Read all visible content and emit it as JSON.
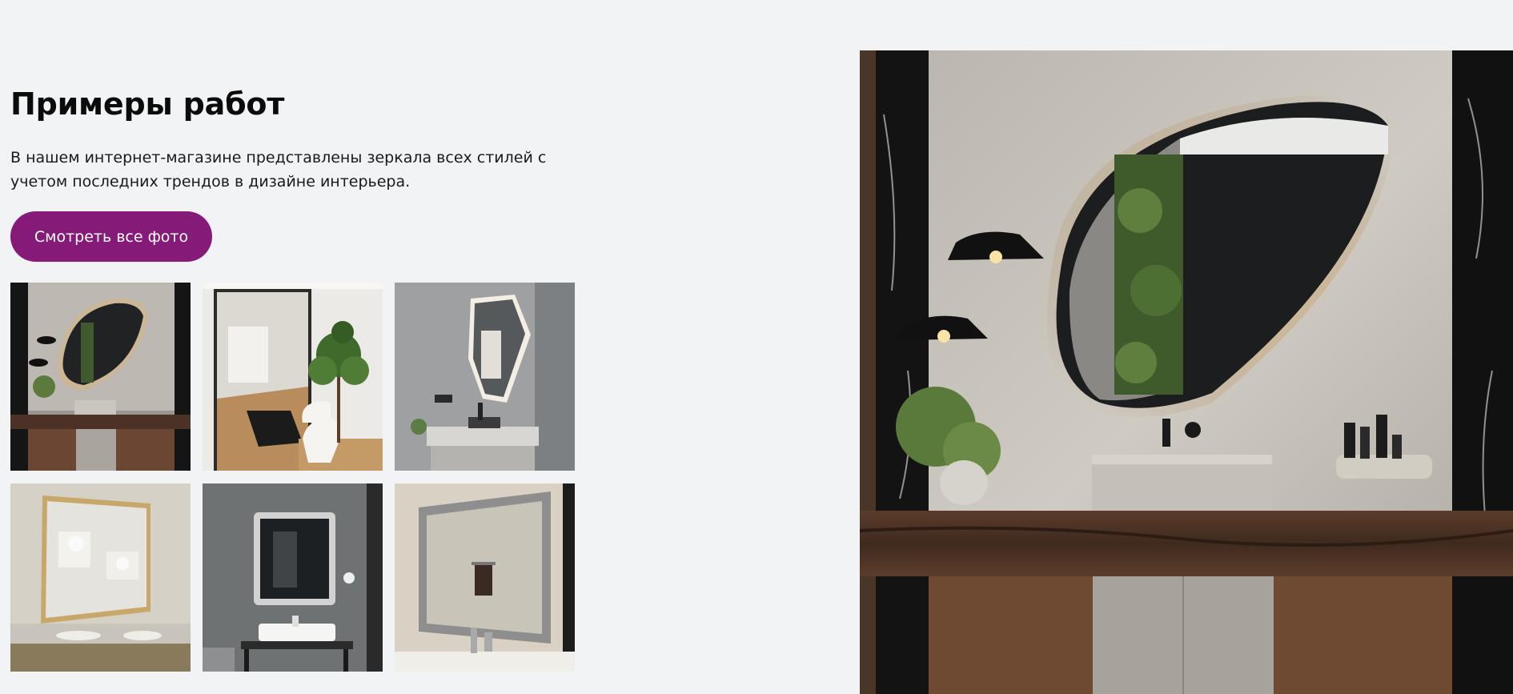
{
  "section": {
    "title": "Примеры работ",
    "description": "В нашем интернет-магазине представлены зеркала всех стилей с учетом последних трендов в дизайне интерьера.",
    "button_label": "Смотреть все фото"
  },
  "colors": {
    "background": "#f2f3f5",
    "accent": "#861a78",
    "text": "#111111"
  },
  "gallery": [
    {
      "icon": "photo-organic-mirror-wall"
    },
    {
      "icon": "photo-floor-mirror-plant"
    },
    {
      "icon": "photo-backlit-polygon-mirror"
    },
    {
      "icon": "photo-gilded-mirror-double-sink"
    },
    {
      "icon": "photo-backlit-square-mirror"
    },
    {
      "icon": "photo-silver-baroque-mirror"
    }
  ],
  "hero_image": {
    "icon": "photo-organic-mirror-large"
  }
}
